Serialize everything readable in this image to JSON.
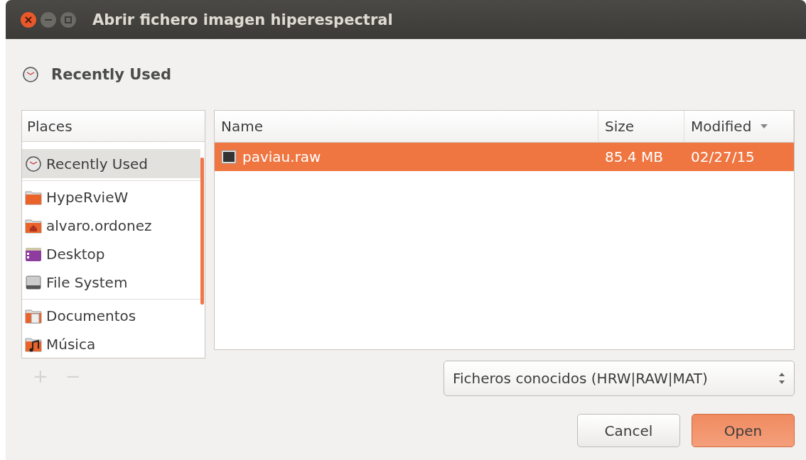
{
  "window": {
    "title": "Abrir fichero imagen hiperespectral"
  },
  "location": {
    "label": "Recently Used"
  },
  "places": {
    "header": "Places",
    "groups": [
      [
        {
          "label": "Recently Used",
          "kind": "recent",
          "selected": true
        }
      ],
      [
        {
          "label": "HypeRvieW",
          "kind": "folder",
          "selected": false
        },
        {
          "label": "alvaro.ordonez",
          "kind": "home",
          "selected": false
        },
        {
          "label": "Desktop",
          "kind": "desktop",
          "selected": false
        },
        {
          "label": "File System",
          "kind": "drive",
          "selected": false
        }
      ],
      [
        {
          "label": "Documentos",
          "kind": "documents",
          "selected": false
        },
        {
          "label": "Música",
          "kind": "music",
          "selected": false
        }
      ]
    ],
    "add": {
      "label": "+",
      "disabled": true
    },
    "remove": {
      "label": "−",
      "disabled": true
    }
  },
  "files": {
    "columns": [
      {
        "label": "Name",
        "sorted": false
      },
      {
        "label": "Size",
        "sorted": false
      },
      {
        "label": "Modified",
        "sorted": true
      }
    ],
    "rows": [
      {
        "name": "paviau.raw",
        "size": "85.4 MB",
        "modified": "02/27/15",
        "selected": true
      }
    ]
  },
  "filter": {
    "value": "Ficheros conocidos (HRW|RAW|MAT)"
  },
  "buttons": [
    {
      "label": "Cancel",
      "kind": "normal"
    },
    {
      "label": "Open",
      "kind": "default"
    }
  ]
}
